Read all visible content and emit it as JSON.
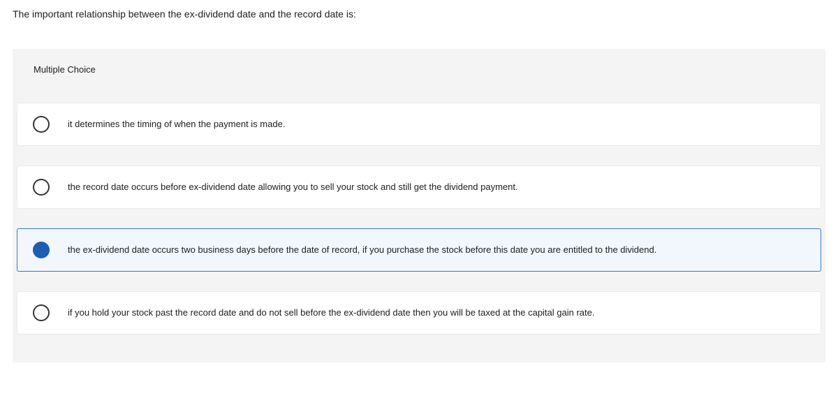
{
  "question": "The important relationship between the ex-dividend date and the record date is:",
  "section_label": "Multiple Choice",
  "options": [
    {
      "text": "it determines the timing of when the payment is made.",
      "selected": false
    },
    {
      "text": "the record date occurs before ex-dividend date allowing you to sell your stock and still get the dividend payment.",
      "selected": false
    },
    {
      "text": "the ex-dividend date occurs two business days before the date of record, if you purchase the stock before this date you are entitled to the dividend.",
      "selected": true
    },
    {
      "text": "if you hold your stock past the record date and do not sell before the ex-dividend date then you will be taxed at the capital gain rate.",
      "selected": false
    }
  ]
}
